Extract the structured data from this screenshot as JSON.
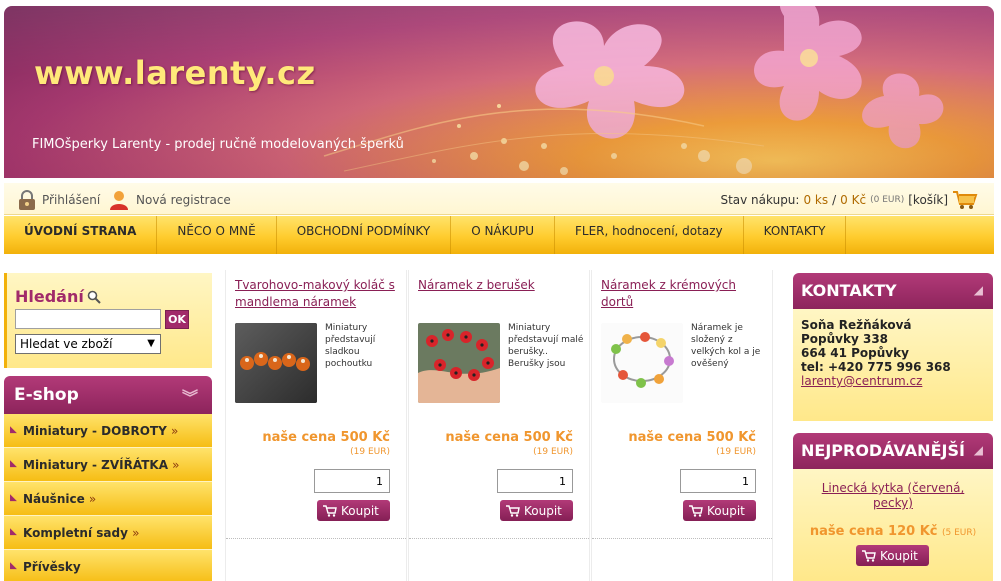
{
  "header": {
    "site_title": "www.larenty.cz",
    "tagline": "FIMOšperky Larenty - prodej ručně modelovaných šperků"
  },
  "userbar": {
    "login": "Přihlášení",
    "register": "Nová registrace",
    "cart_label": "Stav nákupu:",
    "cart_count": "0 ks",
    "cart_sep": "/",
    "cart_price": "0 Kč",
    "cart_eur": "(0 EUR)",
    "cart_link": "[košík]"
  },
  "nav": {
    "items": [
      {
        "label": "ÚVODNÍ STRANA"
      },
      {
        "label": "NĚCO O MNĚ"
      },
      {
        "label": "OBCHODNÍ PODMÍNKY"
      },
      {
        "label": "O NÁKUPU"
      },
      {
        "label": "FLER, hodnocení, dotazy"
      },
      {
        "label": "KONTAKTY"
      }
    ]
  },
  "search": {
    "title": "Hledání",
    "ok": "OK",
    "select_value": "Hledat ve zboží"
  },
  "eshop": {
    "title": "E-shop",
    "categories": [
      {
        "label": "Miniatury - DOBROTY"
      },
      {
        "label": "Miniatury - ZVÍŘÁTKA"
      },
      {
        "label": "Náušnice"
      },
      {
        "label": "Kompletní sady"
      },
      {
        "label": "Přívěsky"
      }
    ],
    "raquo": "»"
  },
  "products": [
    {
      "title": "Tvarohovo-makový koláč s mandlema náramek",
      "desc": "Miniatury představují sladkou pochoutku",
      "price": "naše cena 500 Kč",
      "eur": "(19 EUR)",
      "qty": "1",
      "buy": "Koupit"
    },
    {
      "title": "Náramek z berušek",
      "desc": "Miniatury představují malé berušky.. Berušky jsou",
      "price": "naše cena 500 Kč",
      "eur": "(19 EUR)",
      "qty": "1",
      "buy": "Koupit"
    },
    {
      "title": "Náramek z krémových dortů",
      "desc": "Náramek je složený z velkých kol a je ověšený",
      "price": "naše cena 500 Kč",
      "eur": "(19 EUR)",
      "qty": "1",
      "buy": "Koupit"
    }
  ],
  "contacts": {
    "title": "KONTAKTY",
    "name": "Soňa Režňáková",
    "street": "Popůvky 338",
    "city": "664 41 Popůvky",
    "phone": "tel: +420 775 996 368",
    "email": "larenty@centrum.cz"
  },
  "bestsellers": {
    "title": "NEJPRODÁVANĚJŠÍ",
    "item_name": "Linecká kytka (červená, pecky)",
    "price": "naše cena 120 Kč",
    "eur": "(5 EUR)",
    "buy": "Koupit"
  },
  "colors": {
    "brand_purple": "#a12a6a",
    "nav_yellow": "#ffcc2e",
    "price_orange": "#f0962e"
  }
}
